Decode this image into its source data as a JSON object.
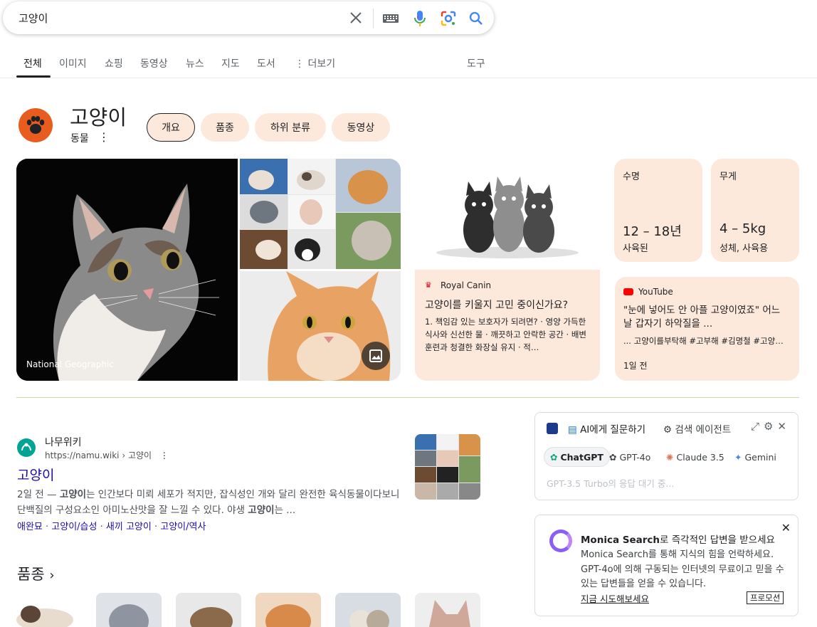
{
  "search": {
    "query": "고양이",
    "icons": [
      "close-icon",
      "keyboard-icon",
      "microphone-icon",
      "google-lens-icon",
      "search-icon"
    ]
  },
  "tabs": {
    "items": [
      "전체",
      "이미지",
      "쇼핑",
      "동영상",
      "뉴스",
      "지도",
      "도서"
    ],
    "more": "⋮ 더보기",
    "tools": "도구",
    "active": "전체"
  },
  "knowledge_panel": {
    "title": "고양이",
    "subtitle": "동물",
    "chips": [
      "개요",
      "품종",
      "하위 분류",
      "동영상"
    ],
    "selected_chip": "개요",
    "image_caption": "National Geographic",
    "royal_canin": {
      "source": "Royal Canin",
      "title": "고양이를 키울지 고민 중이신가요?",
      "body": "1. 책임감 있는 보호자가 되려면? · 영양 가득한 식사와 신선한 물 · 깨끗하고 안락한 공간 · 배변 훈련과 청결한 화장실 유지 · 적…"
    },
    "lifespan": {
      "label": "수명",
      "value": "12 – 18년",
      "caption": "사육된"
    },
    "weight": {
      "label": "무게",
      "value": "4 – 5kg",
      "caption": "성체, 사육용"
    },
    "youtube": {
      "source": "YouTube",
      "title": "\"눈에 넣어도 안 아플 고양이였죠\" 어느 날 갑자기 하악질을 ...",
      "tags": "... 고양이를부탁해 #고부해 #김명철 #고양…",
      "age": "1일 전"
    }
  },
  "result": {
    "site": "나무위키",
    "url": "https://namu.wiki › 고양이",
    "title": "고양이",
    "snippet_date": "2일 전 — ",
    "snippet_bold": "고양이",
    "snippet_text": "는 인간보다 미뢰 세포가 적지만, 잡식성인 개와 달리 완전한 육식동물이다보니 단백질의 구성요소인 아미노산맛을 잘 느낄 수 있다. 야생 ",
    "snippet_bold2": "고양이",
    "snippet_text2": "는 ...",
    "links": [
      "애완묘",
      "고양이/습성",
      "새끼 고양이",
      "고양이/역사"
    ]
  },
  "breeds": {
    "heading": "품종"
  },
  "ai_panel": {
    "ask_label": "AI에게 질문하기",
    "agent_label": "검색 에이전트",
    "models": [
      "ChatGPT",
      "GPT-4o",
      "Claude 3.5",
      "Gemini"
    ],
    "selected_model": "ChatGPT",
    "waiting": "GPT-3.5 Turbo의 응답 대기 중..."
  },
  "monica": {
    "title_bold": "Monica Search",
    "title_rest": "로 즉각적인 답변을 받으세요",
    "body": "Monica Search를 통해 지식의 힘을 언락하세요. GPT-4o에 의해 구동되는 인터넷의 무료이고 믿을 수 있는 답변들을 얻을 수 있습니다.",
    "try_label": "지금 시도해보세요",
    "promo_label": "프로모션"
  },
  "colors": {
    "accent_chip": "#fde9dc",
    "link": "#1a0dab",
    "paw_bg": "#e85c1f"
  }
}
